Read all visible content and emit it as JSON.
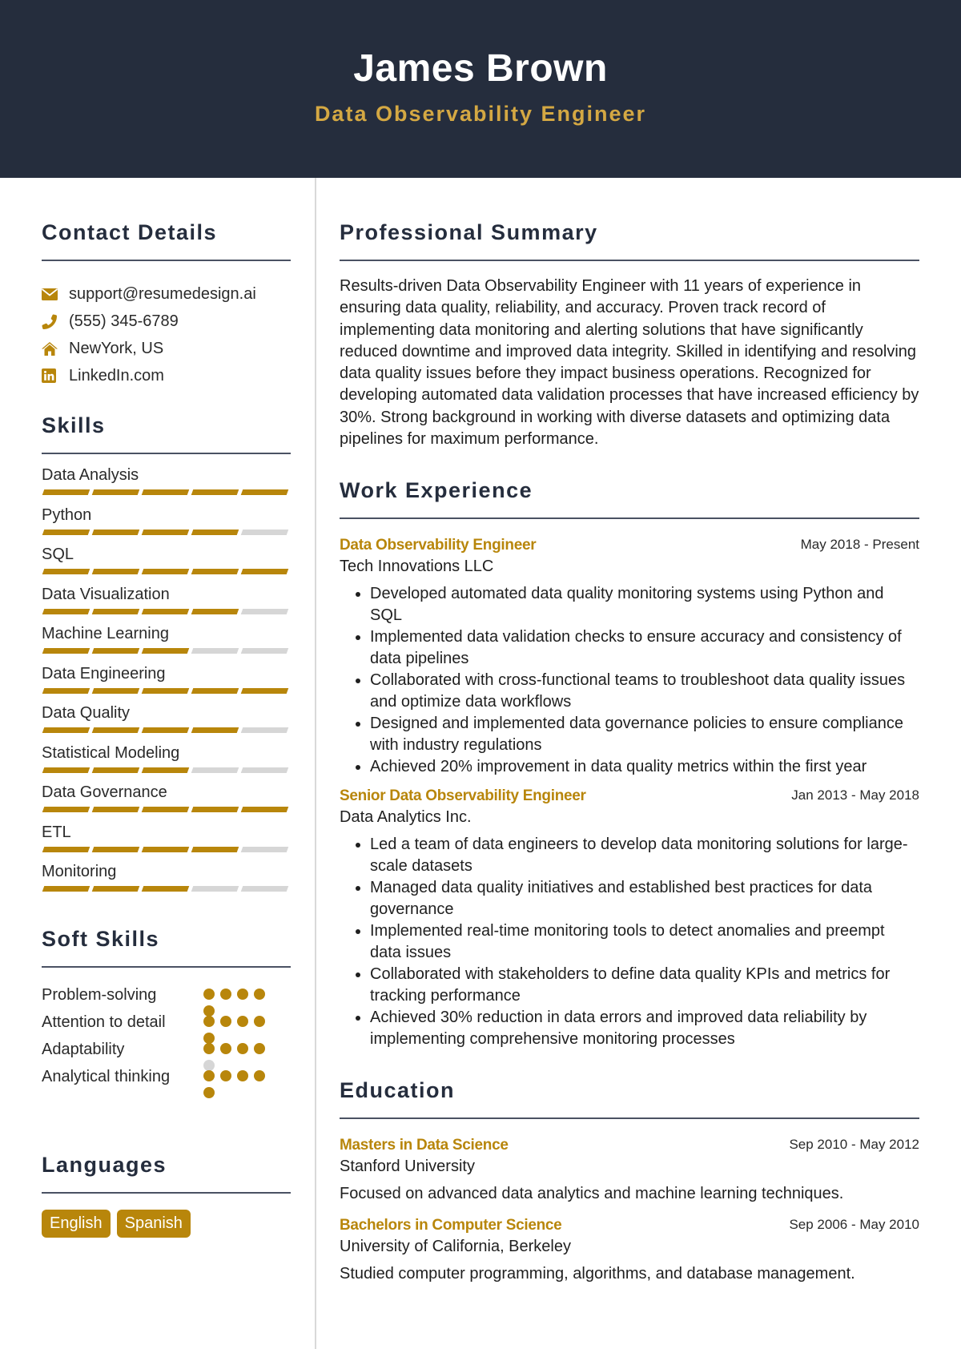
{
  "header": {
    "name": "James Brown",
    "role": "Data Observability Engineer"
  },
  "colors": {
    "header_bg": "#252d3d",
    "accent": "#b8860b",
    "role_text": "#d4a843",
    "inactive": "#d6d6d6"
  },
  "contact": {
    "title": "Contact Details",
    "items": [
      {
        "icon": "envelope-icon",
        "text": "support@resumedesign.ai"
      },
      {
        "icon": "phone-icon",
        "text": "(555) 345-6789"
      },
      {
        "icon": "home-icon",
        "text": "NewYork, US"
      },
      {
        "icon": "linkedin-icon",
        "text": "LinkedIn.com"
      }
    ]
  },
  "skills": {
    "title": "Skills",
    "max": 5,
    "items": [
      {
        "name": "Data Analysis",
        "level": 5
      },
      {
        "name": "Python",
        "level": 4
      },
      {
        "name": "SQL",
        "level": 5
      },
      {
        "name": "Data Visualization",
        "level": 4
      },
      {
        "name": "Machine Learning",
        "level": 3
      },
      {
        "name": "Data Engineering",
        "level": 5
      },
      {
        "name": "Data Quality",
        "level": 4
      },
      {
        "name": "Statistical Modeling",
        "level": 3
      },
      {
        "name": "Data Governance",
        "level": 5
      },
      {
        "name": "ETL",
        "level": 4
      },
      {
        "name": "Monitoring",
        "level": 3
      }
    ]
  },
  "soft_skills": {
    "title": "Soft Skills",
    "max": 5,
    "items": [
      {
        "name": "Problem-solving",
        "level": 5
      },
      {
        "name": "Attention to detail",
        "level": 5
      },
      {
        "name": "Adaptability",
        "level": 4
      },
      {
        "name": "Analytical thinking",
        "level": 5
      }
    ]
  },
  "languages": {
    "title": "Languages",
    "items": [
      "English",
      "Spanish"
    ]
  },
  "summary": {
    "title": "Professional Summary",
    "text": "Results-driven Data Observability Engineer with 11 years of experience in ensuring data quality, reliability, and accuracy. Proven track record of implementing data monitoring and alerting solutions that have significantly reduced downtime and improved data integrity. Skilled in identifying and resolving data quality issues before they impact business operations. Recognized for developing automated data validation processes that have increased efficiency by 30%. Strong background in working with diverse datasets and optimizing data pipelines for maximum performance."
  },
  "experience": {
    "title": "Work Experience",
    "jobs": [
      {
        "title": "Data Observability Engineer",
        "company": "Tech Innovations LLC",
        "dates": "May 2018 - Present",
        "bullets": [
          "Developed automated data quality monitoring systems using Python and SQL",
          "Implemented data validation checks to ensure accuracy and consistency of data pipelines",
          "Collaborated with cross-functional teams to troubleshoot data quality issues and optimize data workflows",
          "Designed and implemented data governance policies to ensure compliance with industry regulations",
          "Achieved 20% improvement in data quality metrics within the first year"
        ]
      },
      {
        "title": "Senior Data Observability Engineer",
        "company": "Data Analytics Inc.",
        "dates": "Jan 2013 - May 2018",
        "bullets": [
          "Led a team of data engineers to develop data monitoring solutions for large-scale datasets",
          "Managed data quality initiatives and established best practices for data governance",
          "Implemented real-time monitoring tools to detect anomalies and preempt data issues",
          "Collaborated with stakeholders to define data quality KPIs and metrics for tracking performance",
          "Achieved 30% reduction in data errors and improved data reliability by implementing comprehensive monitoring processes"
        ]
      }
    ]
  },
  "education": {
    "title": "Education",
    "items": [
      {
        "degree": "Masters in Data Science",
        "school": "Stanford University",
        "dates": "Sep 2010 - May 2012",
        "description": "Focused on advanced data analytics and machine learning techniques."
      },
      {
        "degree": "Bachelors in Computer Science",
        "school": "University of California, Berkeley",
        "dates": "Sep 2006 - May 2010",
        "description": "Studied computer programming, algorithms, and database management."
      }
    ]
  }
}
